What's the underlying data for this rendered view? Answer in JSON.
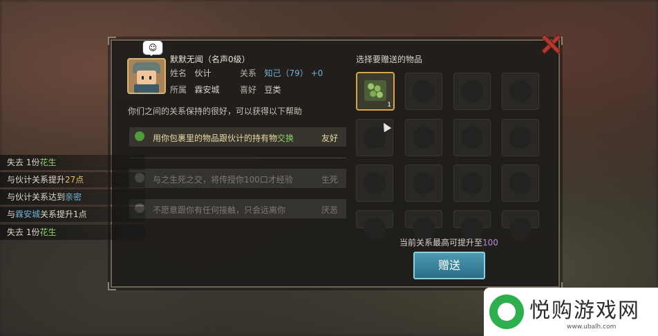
{
  "npc": {
    "name_line": "默默无闻（名声0级）",
    "emote": "☺",
    "name_label": "姓名",
    "name_value": "伙计",
    "relation_label": "关系",
    "relation_value": "知己（79）",
    "relation_delta": "+0",
    "faction_label": "所属",
    "faction_value": "霖安城",
    "hobby_label": "喜好",
    "hobby_value": "豆类"
  },
  "help_intro": "你们之间的关系保持的很好，可以获得以下帮助",
  "benefits": [
    {
      "text_pre": "用你包裹里的物品跟伙计的持有物",
      "text_highlight": "交换",
      "tag": "友好",
      "locked": false
    },
    {
      "text": "与之生死之交，将传授你100口才经验",
      "tag": "生死",
      "locked": true
    },
    {
      "text": "不愿意跟你有任何接触，只会远离你",
      "tag": "厌恶",
      "locked": true
    }
  ],
  "gift": {
    "title": "选择要赠送的物品",
    "selected_item_qty": "1",
    "limit_text": "当前关系最高可提升至",
    "limit_value": "100",
    "button": "赠送"
  },
  "log": [
    {
      "pre": "失去 1份",
      "hl": "花生",
      "post": ""
    },
    {
      "pre": "与伙计关系提升",
      "hl": "27点",
      "post": ""
    },
    {
      "pre": "与伙计关系达到",
      "hl": "亲密",
      "post": ""
    },
    {
      "pre": "与",
      "hl": "霖安城",
      "post": "关系提升1点"
    },
    {
      "pre": "失去 1份",
      "hl": "花生",
      "post": ""
    }
  ],
  "watermark": {
    "name": "悦购游戏网",
    "url": "www.ubalh.com"
  }
}
